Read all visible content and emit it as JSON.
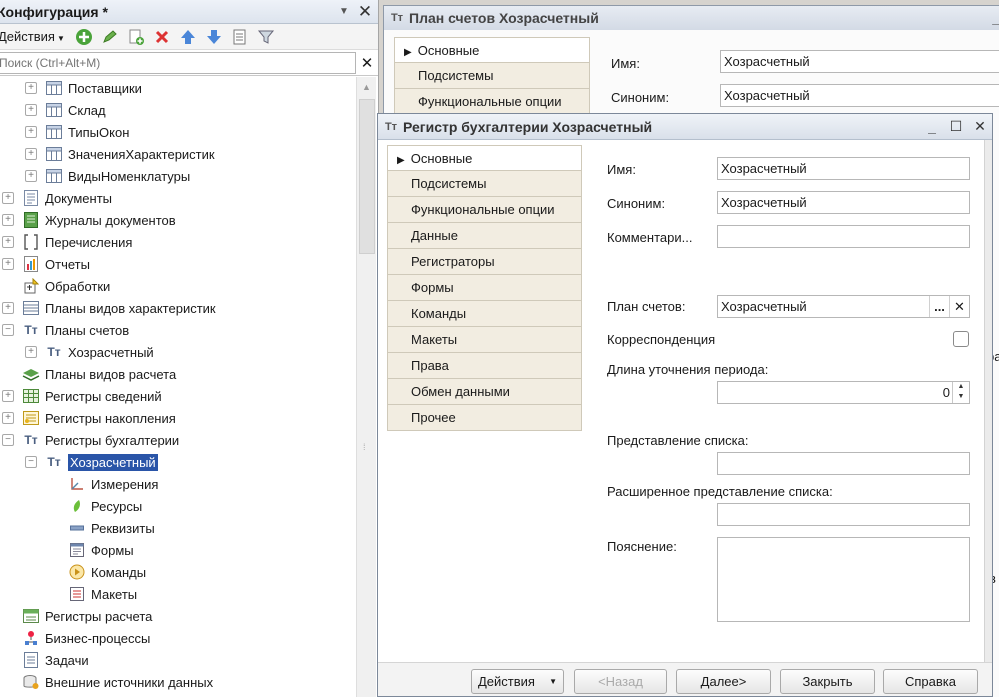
{
  "left_panel": {
    "title": "Конфигурация *",
    "pin_icon": "pin-icon",
    "actions_label": "Действия",
    "search_placeholder": "Поиск (Ctrl+Alt+M)",
    "tree": [
      {
        "label": "Поставщики",
        "icon": "catalog-icon",
        "indent": 1,
        "expander": "plus"
      },
      {
        "label": "Склад",
        "icon": "catalog-icon",
        "indent": 1,
        "expander": "plus"
      },
      {
        "label": "ТипыОкон",
        "icon": "catalog-icon",
        "indent": 1,
        "expander": "plus"
      },
      {
        "label": "ЗначенияХарактеристик",
        "icon": "catalog-icon",
        "indent": 1,
        "expander": "plus"
      },
      {
        "label": "ВидыНоменклатуры",
        "icon": "catalog-icon",
        "indent": 1,
        "expander": "plus"
      },
      {
        "label": "Документы",
        "icon": "document-icon",
        "indent": 0,
        "expander": "plus"
      },
      {
        "label": "Журналы документов",
        "icon": "journal-icon",
        "indent": 0,
        "expander": "plus"
      },
      {
        "label": "Перечисления",
        "icon": "enum-icon",
        "indent": 0,
        "expander": "plus"
      },
      {
        "label": "Отчеты",
        "icon": "report-icon",
        "indent": 0,
        "expander": "plus"
      },
      {
        "label": "Обработки",
        "icon": "processing-icon",
        "indent": 0,
        "expander": "none"
      },
      {
        "label": "Планы видов характеристик",
        "icon": "chart-of-characteristics-icon",
        "indent": 0,
        "expander": "plus"
      },
      {
        "label": "Планы счетов",
        "icon": "chart-of-accounts-icon",
        "indent": 0,
        "expander": "minus"
      },
      {
        "label": "Хозрасчетный",
        "icon": "chart-of-accounts-icon",
        "indent": 1,
        "expander": "plus"
      },
      {
        "label": "Планы видов расчета",
        "icon": "calculation-types-icon",
        "indent": 0,
        "expander": "none"
      },
      {
        "label": "Регистры сведений",
        "icon": "info-register-icon",
        "indent": 0,
        "expander": "plus"
      },
      {
        "label": "Регистры накопления",
        "icon": "accumulation-register-icon",
        "indent": 0,
        "expander": "plus"
      },
      {
        "label": "Регистры бухгалтерии",
        "icon": "accounting-register-icon",
        "indent": 0,
        "expander": "minus"
      },
      {
        "label": "Хозрасчетный",
        "icon": "accounting-register-icon",
        "indent": 1,
        "expander": "minus",
        "selected": true
      },
      {
        "label": "Измерения",
        "icon": "dimensions-icon",
        "indent": 2,
        "expander": "none"
      },
      {
        "label": "Ресурсы",
        "icon": "resources-icon",
        "indent": 2,
        "expander": "none"
      },
      {
        "label": "Реквизиты",
        "icon": "attributes-icon",
        "indent": 2,
        "expander": "none"
      },
      {
        "label": "Формы",
        "icon": "forms-icon",
        "indent": 2,
        "expander": "none"
      },
      {
        "label": "Команды",
        "icon": "commands-icon",
        "indent": 2,
        "expander": "none"
      },
      {
        "label": "Макеты",
        "icon": "templates-icon",
        "indent": 2,
        "expander": "none"
      },
      {
        "label": "Регистры расчета",
        "icon": "calculation-register-icon",
        "indent": 0,
        "expander": "none"
      },
      {
        "label": "Бизнес-процессы",
        "icon": "business-process-icon",
        "indent": 0,
        "expander": "none"
      },
      {
        "label": "Задачи",
        "icon": "task-icon",
        "indent": 0,
        "expander": "none"
      },
      {
        "label": "Внешние источники данных",
        "icon": "external-data-icon",
        "indent": 0,
        "expander": "none"
      }
    ]
  },
  "back_window": {
    "title": "План счетов Хозрасчетный",
    "tabs": [
      "Основные",
      "Подсистемы",
      "Функциональные опции"
    ],
    "name_label": "Имя:",
    "name_value": "Хозрасчетный",
    "synonym_label": "Синоним:",
    "synonym_value": "Хозрасчетный",
    "edge_text_1": "ра",
    "edge_text_2": "в"
  },
  "front_window": {
    "title": "Регистр бухгалтерии Хозрасчетный",
    "tabs": [
      "Основные",
      "Подсистемы",
      "Функциональные опции",
      "Данные",
      "Регистраторы",
      "Формы",
      "Команды",
      "Макеты",
      "Права",
      "Обмен данными",
      "Прочее"
    ],
    "name_label": "Имя:",
    "name_value": "Хозрасчетный",
    "synonym_label": "Синоним:",
    "synonym_value": "Хозрасчетный",
    "comment_label": "Комментари...",
    "comment_value": "",
    "chart_label": "План счетов:",
    "chart_value": "Хозрасчетный",
    "chart_select": "...",
    "chart_clear": "✕",
    "corr_label": "Корреспонденция",
    "corr_checked": false,
    "period_label": "Длина уточнения периода:",
    "period_value": "0",
    "list_label": "Представление списка:",
    "list_value": "",
    "ext_list_label": "Расширенное представление списка:",
    "ext_list_value": "",
    "note_label": "Пояснение:",
    "note_value": "",
    "buttons": {
      "actions": "Действия",
      "back": "<Назад",
      "next": "Далее>",
      "close": "Закрыть",
      "help": "Справка"
    }
  }
}
